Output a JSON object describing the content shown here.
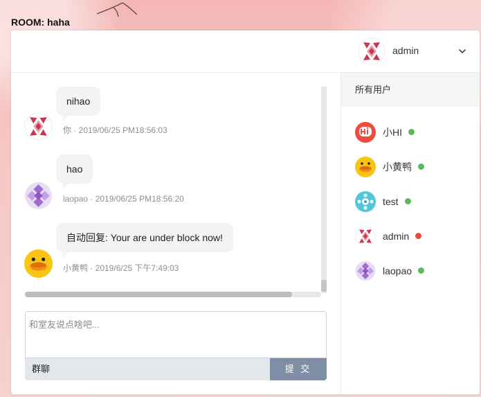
{
  "room": {
    "title": "ROOM: haha"
  },
  "header": {
    "username": "admin",
    "avatar_icon": "red-geometric-avatar-icon",
    "dropdown_icon": "chevron-down-icon"
  },
  "messages": [
    {
      "text": "nihao",
      "meta": "你 · 2019/06/25 PM18:56:03",
      "avatar_icon": "red-geometric-avatar-icon"
    },
    {
      "text": "hao",
      "meta": "laopao · 2019/06/25 PM18:56:20",
      "avatar_icon": "purple-pattern-avatar-icon"
    },
    {
      "text": "自动回复: Your are under block now!",
      "meta": "小黄鸭 · 2019/6/25 下午7:49:03",
      "avatar_icon": "yellow-duck-avatar-icon"
    }
  ],
  "composer": {
    "placeholder": "和室友说点啥吧...",
    "value": "",
    "mode_label": "群聊",
    "submit_label": "提 交"
  },
  "users_panel": {
    "title": "所有用户",
    "users": [
      {
        "name": "小HI",
        "status": "online",
        "status_color": "#5cb85c",
        "avatar_icon": "red-hi-avatar-icon"
      },
      {
        "name": "小黄鸭",
        "status": "online",
        "status_color": "#5cb85c",
        "avatar_icon": "yellow-duck-avatar-icon"
      },
      {
        "name": "test",
        "status": "online",
        "status_color": "#5cb85c",
        "avatar_icon": "cyan-pattern-avatar-icon"
      },
      {
        "name": "admin",
        "status": "offline",
        "status_color": "#e74c3c",
        "avatar_icon": "red-geometric-avatar-icon"
      },
      {
        "name": "laopao",
        "status": "online",
        "status_color": "#5cb85c",
        "avatar_icon": "purple-pattern-avatar-icon"
      }
    ]
  },
  "colors": {
    "submit_button": "#7e8fa5",
    "bubble_background": "#f2f3f5",
    "online": "#5cb85c",
    "offline": "#e74c3c"
  }
}
